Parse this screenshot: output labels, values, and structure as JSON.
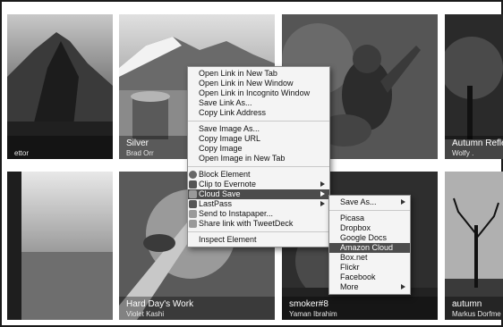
{
  "gallery": {
    "tiles": [
      {
        "title": "",
        "author": "ettor"
      },
      {
        "title": "Silver",
        "author": "Brad Orr"
      },
      {
        "title": "",
        "author": ""
      },
      {
        "title": "Autumn Refle",
        "author": "Wolfy ."
      },
      {
        "title": "",
        "author": ""
      },
      {
        "title": "Hard Day's Work",
        "author": "Violet Kashi"
      },
      {
        "title": "smoker#8",
        "author": "Yaman Ibrahim"
      },
      {
        "title": "autumn",
        "author": "Markus Dorfme"
      }
    ]
  },
  "context_menu": {
    "items": [
      "Open Link in New Tab",
      "Open Link in New Window",
      "Open Link in Incognito Window",
      "Save Link As...",
      "Copy Link Address",
      "Save Image As...",
      "Copy Image URL",
      "Copy Image",
      "Open Image in New Tab",
      "Block Element",
      "Clip to Evernote",
      "Cloud Save",
      "LastPass",
      "Send to Instapaper...",
      "Share link with TweetDeck",
      "Inspect Element"
    ],
    "icons": {
      "block": "block-icon",
      "evernote": "evernote-icon",
      "cloud": "cloud-save-icon",
      "lastpass": "lastpass-icon",
      "instapaper": "instapaper-icon",
      "tweetdeck": "checkbox-icon"
    }
  },
  "cloud_submenu": {
    "items": [
      "Save As...",
      "Picasa",
      "Dropbox",
      "Google Docs",
      "Amazon Cloud",
      "Box.net",
      "Flickr",
      "Facebook",
      "More"
    ],
    "highlighted": "Amazon Cloud"
  },
  "colors": {
    "menu_background": "#f4f4f4",
    "highlight": "#4c4c4c",
    "frame": "#1a1a1a"
  }
}
